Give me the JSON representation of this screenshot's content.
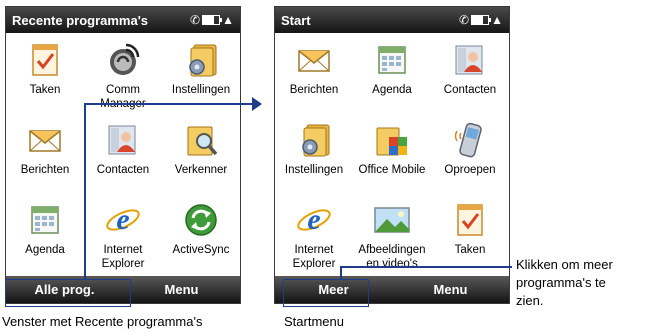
{
  "left_screen": {
    "title": "Recente programma's",
    "tiles": [
      {
        "label": "Taken",
        "icon": "tasks-icon"
      },
      {
        "label": "Comm\nManager",
        "icon": "comm-manager-icon"
      },
      {
        "label": "Instellingen",
        "icon": "settings-icon"
      },
      {
        "label": "Berichten",
        "icon": "messages-icon"
      },
      {
        "label": "Contacten",
        "icon": "contacts-icon"
      },
      {
        "label": "Verkenner",
        "icon": "explorer-icon"
      },
      {
        "label": "Agenda",
        "icon": "calendar-icon"
      },
      {
        "label": "Internet\nExplorer",
        "icon": "internet-explorer-icon"
      },
      {
        "label": "ActiveSync",
        "icon": "activesync-icon"
      }
    ],
    "softkey_left": "Alle prog.",
    "softkey_right": "Menu"
  },
  "right_screen": {
    "title": "Start",
    "tiles": [
      {
        "label": "Berichten",
        "icon": "messages-icon"
      },
      {
        "label": "Agenda",
        "icon": "calendar-icon"
      },
      {
        "label": "Contacten",
        "icon": "contacts-icon"
      },
      {
        "label": "Instellingen",
        "icon": "settings-icon"
      },
      {
        "label": "Office Mobile",
        "icon": "office-mobile-icon"
      },
      {
        "label": "Oproepen",
        "icon": "phone-icon"
      },
      {
        "label": "Internet\nExplorer",
        "icon": "internet-explorer-icon"
      },
      {
        "label": "Afbeeldingen\nen video's",
        "icon": "pictures-icon"
      },
      {
        "label": "Taken",
        "icon": "tasks-icon"
      }
    ],
    "softkey_left": "Meer",
    "softkey_right": "Menu"
  },
  "captions": {
    "left": "Venster met Recente programma's",
    "right": "Startmenu",
    "more": "Klikken om meer\nprogramma's te\nzien."
  },
  "colors": {
    "callout": "#1f3d8a",
    "bar_dark": "#151515"
  }
}
